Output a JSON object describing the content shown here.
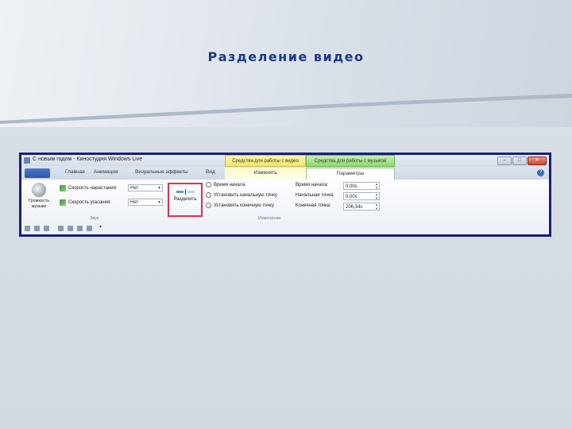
{
  "slide": {
    "title": "Разделение видео"
  },
  "window": {
    "title": "С новым годом - Киностудия Windows Live",
    "contextual_tabs": {
      "video": "Средства для работы с видео",
      "music": "Средства для работы с музыкой"
    },
    "buttons": {
      "minimize": "–",
      "maximize": "□",
      "close": "✕"
    }
  },
  "ribbon_tabs": {
    "home": "Главная",
    "animation": "Анимация",
    "visual_effects": "Визуальные эффекты",
    "view": "Вид",
    "edit": "Изменить",
    "options": "Параметры",
    "help": "?"
  },
  "sound_group": {
    "label": "Звук",
    "music_volume": "Громкость музыки",
    "fade_in_label": "Скорость нарастания:",
    "fade_in_value": "Нет",
    "fade_out_label": "Скорость угасания:",
    "fade_out_value": "Нет"
  },
  "edit_group": {
    "label": "Изменение",
    "split": "Разделить",
    "set_start_time": "Время начала",
    "set_start_point": "Установить начальную точку",
    "set_end_point": "Установить конечную точку",
    "start_time_label": "Время начала:",
    "start_time_value": "0,00s",
    "start_point_label": "Начальная точка:",
    "start_point_value": "0,00s",
    "end_point_label": "Конечная точка:",
    "end_point_value": "206,34s"
  },
  "colors": {
    "title": "#1b3a8a",
    "frame": "#16207a",
    "highlight": "#d8344a"
  }
}
